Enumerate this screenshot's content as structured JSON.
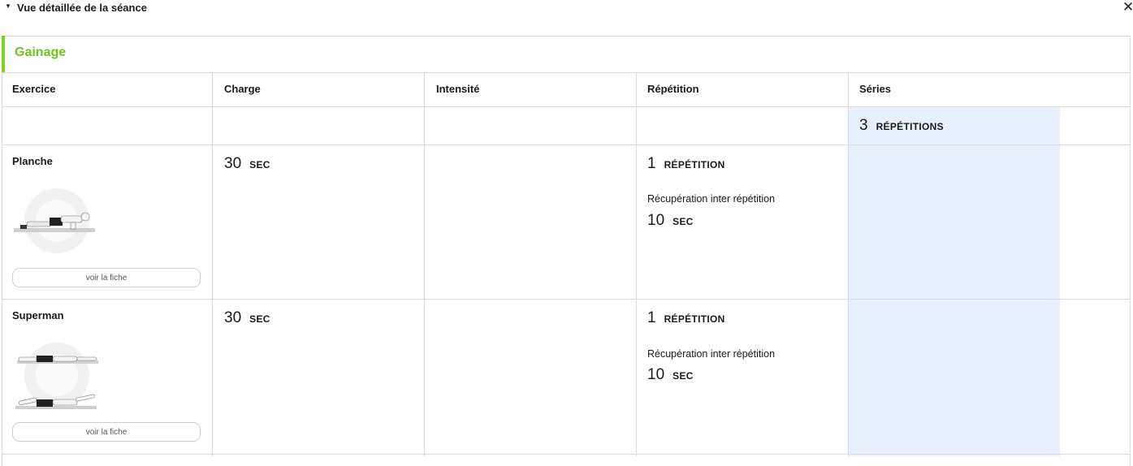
{
  "header": {
    "title": "Vue détaillée de la séance",
    "close_icon": "close-icon",
    "toggle_icon": "caret-down-icon"
  },
  "section": {
    "title": "Gainage",
    "accent_color": "#7ed321"
  },
  "table": {
    "columns": [
      "Exercice",
      "Charge",
      "Intensité",
      "Répétition",
      "Séries"
    ],
    "series_summary": {
      "value": "3",
      "unit": "RÉPÉTITIONS"
    },
    "series_highlight_color": "#e8f0fd",
    "rows": [
      {
        "exercise": "Planche",
        "button_label": "voir la fiche",
        "charge": {
          "value": "30",
          "unit": "SEC"
        },
        "repetition": {
          "value": "1",
          "unit": "RÉPÉTITION"
        },
        "recovery_label": "Récupération inter répétition",
        "recovery": {
          "value": "10",
          "unit": "SEC"
        }
      },
      {
        "exercise": "Superman",
        "button_label": "voir la fiche",
        "charge": {
          "value": "30",
          "unit": "SEC"
        },
        "repetition": {
          "value": "1",
          "unit": "RÉPÉTITION"
        },
        "recovery_label": "Récupération inter répétition",
        "recovery": {
          "value": "10",
          "unit": "SEC"
        }
      }
    ]
  }
}
